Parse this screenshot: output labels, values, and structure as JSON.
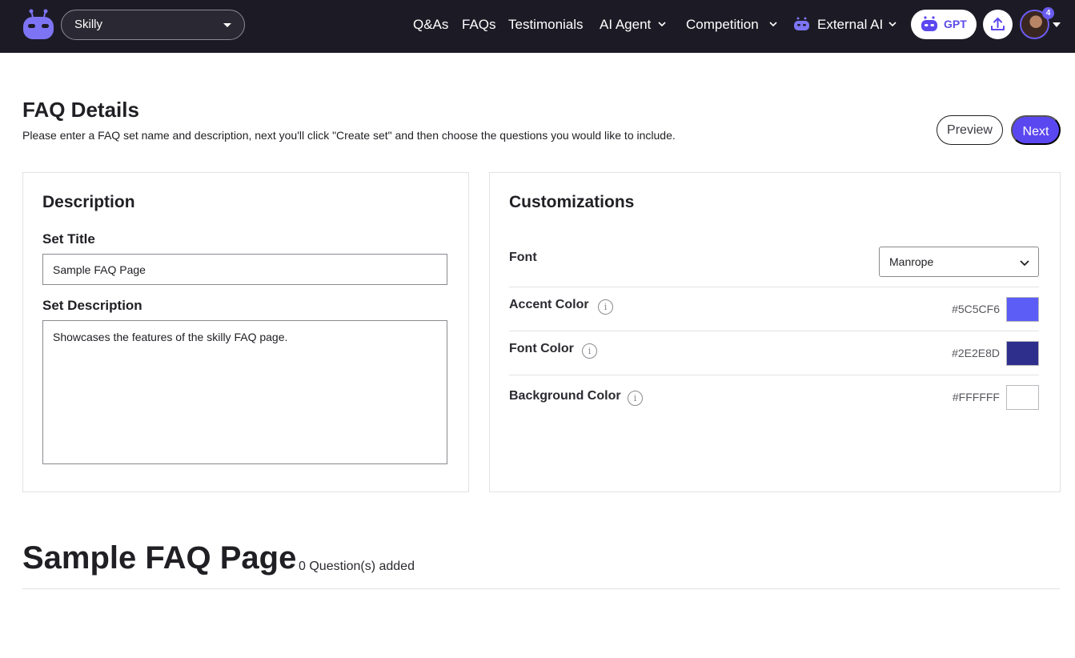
{
  "nav": {
    "workspace": "Skilly",
    "links": [
      "Q&As",
      "FAQs",
      "Testimonials",
      "AI Agent",
      "Competition",
      "External AI"
    ],
    "gpt_label": "GPT",
    "notification_count": "4",
    "accent": "#5b47f0"
  },
  "header": {
    "title": "FAQ Details",
    "subtitle": "Please enter a FAQ set name and description, next you'll click \"Create set\" and then choose the questions you would like to include.",
    "preview_label": "Preview",
    "next_label": "Next"
  },
  "description_card": {
    "heading": "Description",
    "set_title_label": "Set Title",
    "set_title_value": "Sample FAQ Page",
    "set_description_label": "Set Description",
    "set_description_value": "Showcases the features of the skilly FAQ page."
  },
  "customizations_card": {
    "heading": "Customizations",
    "font_label": "Font",
    "font_value": "Manrope",
    "info_glyph": "i",
    "colors": [
      {
        "label": "Accent Color",
        "hex": "#5C5CF6",
        "swatch": "#5C5CF6"
      },
      {
        "label": "Font Color",
        "hex": "#2E2E8D",
        "swatch": "#2E2E8D"
      },
      {
        "label": "Background Color",
        "hex": "#FFFFFF",
        "swatch": "#FFFFFF"
      }
    ]
  },
  "preview_section": {
    "title": "Sample FAQ Page",
    "count_text": "0 Question(s) added"
  }
}
